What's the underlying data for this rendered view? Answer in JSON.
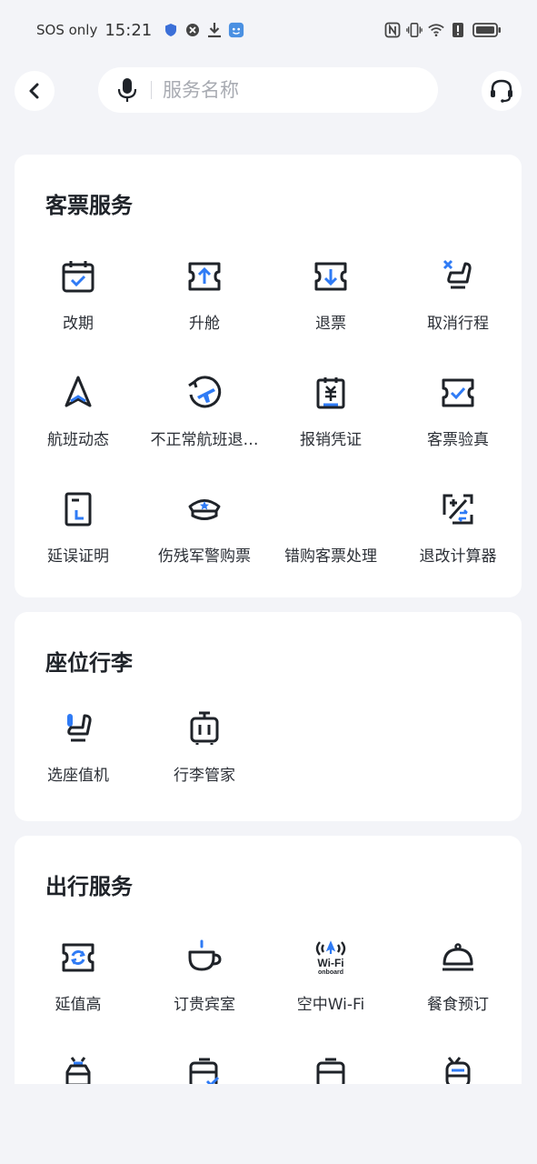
{
  "status_bar": {
    "sos": "SOS only",
    "time": "15:21"
  },
  "search": {
    "placeholder": "服务名称"
  },
  "sections": {
    "ticket": {
      "title": "客票服务",
      "items": [
        {
          "label": "改期",
          "icon": "calendar-check-icon"
        },
        {
          "label": "升舱",
          "icon": "ticket-upgrade-icon"
        },
        {
          "label": "退票",
          "icon": "ticket-refund-icon"
        },
        {
          "label": "取消行程",
          "icon": "cancel-seat-icon"
        },
        {
          "label": "航班动态",
          "icon": "flight-status-icon"
        },
        {
          "label": "不正常航班退…",
          "icon": "irregular-flight-icon"
        },
        {
          "label": "报销凭证",
          "icon": "receipt-icon"
        },
        {
          "label": "客票验真",
          "icon": "ticket-verify-icon"
        },
        {
          "label": "延误证明",
          "icon": "delay-proof-icon"
        },
        {
          "label": "伤残军警购票",
          "icon": "police-cap-icon"
        },
        {
          "label": "错购客票处理",
          "icon": ""
        },
        {
          "label": "退改计算器",
          "icon": "calculator-icon"
        }
      ]
    },
    "seat": {
      "title": "座位行李",
      "items": [
        {
          "label": "选座值机",
          "icon": "seat-checkin-icon"
        },
        {
          "label": "行李管家",
          "icon": "luggage-icon"
        }
      ]
    },
    "travel": {
      "title": "出行服务",
      "items": [
        {
          "label": "延值高",
          "icon": "delay-insurance-icon"
        },
        {
          "label": "订贵宾室",
          "icon": "coffee-cup-icon"
        },
        {
          "label": "空中Wi-Fi",
          "icon": "wifi-onboard-icon",
          "icon_text": "Wi-Fi",
          "icon_subtext": "onboard"
        },
        {
          "label": "餐食预订",
          "icon": "meal-cloche-icon"
        },
        {
          "label": "",
          "icon": "taxi-icon"
        },
        {
          "label": "",
          "icon": "bus-check-icon"
        },
        {
          "label": "",
          "icon": "bus-icon"
        },
        {
          "label": "",
          "icon": "train-icon"
        }
      ]
    }
  },
  "colors": {
    "accent": "#2f7bf5",
    "icon_dark": "#1f2329",
    "background": "#f3f4f8"
  }
}
